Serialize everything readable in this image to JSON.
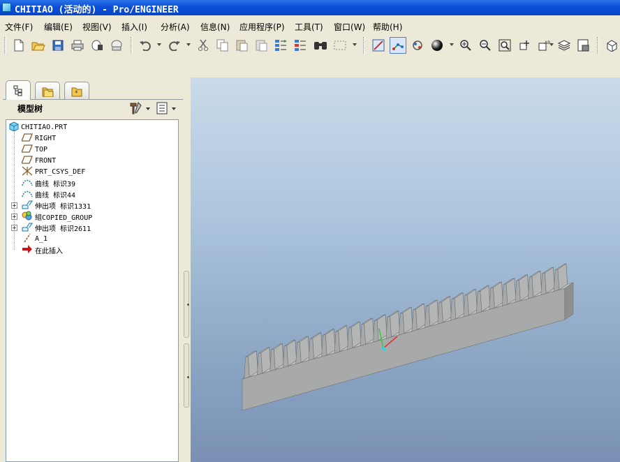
{
  "window": {
    "title": "CHITIAO (活动的) - Pro/ENGINEER"
  },
  "menu": [
    "文件(F)",
    "编辑(E)",
    "视图(V)",
    "插入(I)",
    "分析(A)",
    "信息(N)",
    "应用程序(P)",
    "工具(T)",
    "窗口(W)",
    "帮助(H)"
  ],
  "toolbar": {
    "file_buttons": [
      "new-icon",
      "open-icon",
      "save-icon",
      "print-icon",
      "send-mail-icon",
      "mail-icon"
    ],
    "edit_buttons": [
      "undo-icon",
      "redo-icon",
      "cut-icon",
      "copy-icon",
      "paste-icon",
      "paste-special-icon",
      "regenerate-icon",
      "regen-manager-icon",
      "find-icon",
      "select-box-icon"
    ],
    "view_buttons": [
      "repaint-icon",
      "spin-center-icon",
      "orient-mode-icon",
      "shading-icon",
      "zoom-in-icon",
      "zoom-out-icon",
      "refit-icon",
      "reorient-icon",
      "saved-views-icon",
      "layers-icon",
      "view-manager-icon",
      "model-display-icon"
    ]
  },
  "navigator": {
    "tabs": [
      "model-tree-tab-icon",
      "folder-browser-tab-icon",
      "favorites-tab-icon"
    ],
    "header": "模型树",
    "tools": [
      "settings-icon",
      "show-icon"
    ]
  },
  "model_tree": {
    "root": "CHITIAO.PRT",
    "items": [
      {
        "label": "RIGHT",
        "icon": "datum-plane-icon",
        "expandable": false
      },
      {
        "label": "TOP",
        "icon": "datum-plane-icon",
        "expandable": false
      },
      {
        "label": "FRONT",
        "icon": "datum-plane-icon",
        "expandable": false
      },
      {
        "label": "PRT_CSYS_DEF",
        "icon": "csys-icon",
        "expandable": false
      },
      {
        "label": "曲线 标识39",
        "icon": "curve-icon",
        "expandable": false
      },
      {
        "label": "曲线 标识44",
        "icon": "curve-icon",
        "expandable": false
      },
      {
        "label": "伸出项 标识1331",
        "icon": "protrusion-icon",
        "expandable": true
      },
      {
        "label": "組COPIED_GROUP",
        "icon": "group-icon",
        "expandable": true
      },
      {
        "label": "伸出项 标识2611",
        "icon": "protrusion-icon",
        "expandable": true
      },
      {
        "label": "A_1",
        "icon": "datum-axis-icon",
        "expandable": false
      },
      {
        "label": "在此插入",
        "icon": "insert-here-arrow-icon",
        "expandable": false
      }
    ]
  },
  "viewport": {
    "model": "gear-rack-model",
    "colors": {
      "bg_top": "#c9daea",
      "bg_bottom": "#7990b4",
      "rack_top": "#c3c5c5",
      "rack_side": "#8e9090",
      "rack_front": "#a8aaaa"
    }
  }
}
